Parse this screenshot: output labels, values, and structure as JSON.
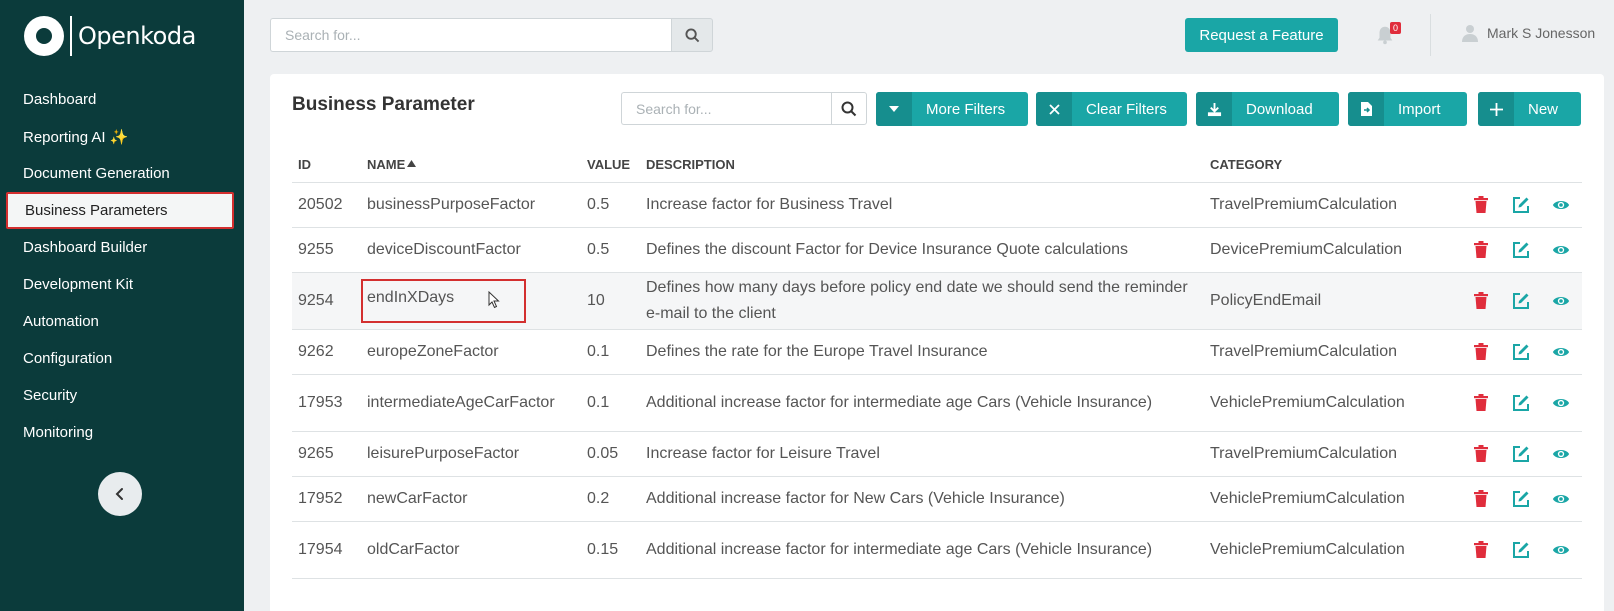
{
  "app": {
    "logo_text": "Openkoda"
  },
  "sidebar": {
    "items": [
      {
        "label": "Dashboard",
        "active": false
      },
      {
        "label": "Reporting AI ✨",
        "active": false
      },
      {
        "label": "Document Generation",
        "active": false
      },
      {
        "label": "Business Parameters",
        "active": true
      },
      {
        "label": "Dashboard Builder",
        "active": false
      },
      {
        "label": "Development Kit",
        "active": false
      },
      {
        "label": "Automation",
        "active": false
      },
      {
        "label": "Configuration",
        "active": false
      },
      {
        "label": "Security",
        "active": false
      },
      {
        "label": "Monitoring",
        "active": false
      }
    ],
    "collapse_icon": "chevron-left-icon"
  },
  "header": {
    "search_placeholder": "Search for...",
    "request_feature_label": "Request a Feature",
    "notification_count": "0",
    "user_name": "Mark S Jonesson"
  },
  "page": {
    "title": "Business Parameter",
    "search_placeholder": "Search for...",
    "buttons": {
      "more_filters": "More Filters",
      "clear_filters": "Clear Filters",
      "download": "Download",
      "import": "Import",
      "new": "New"
    }
  },
  "table": {
    "headers": {
      "id": "ID",
      "name": "NAME",
      "value": "VALUE",
      "description": "DESCRIPTION",
      "category": "CATEGORY"
    },
    "sort": {
      "column": "NAME",
      "direction": "ascending"
    },
    "rows": [
      {
        "id": "20502",
        "name": "businessPurposeFactor",
        "value": "0.5",
        "description": "Increase factor for Business Travel",
        "category": "TravelPremiumCalculation"
      },
      {
        "id": "9255",
        "name": "deviceDiscountFactor",
        "value": "0.5",
        "description": "Defines the discount Factor for Device Insurance Quote calculations",
        "category": "DevicePremiumCalculation"
      },
      {
        "id": "9254",
        "name": "endInXDays",
        "value": "10",
        "description": "Defines how many days before policy end date we should send the reminder e-mail to the client",
        "category": "PolicyEndEmail"
      },
      {
        "id": "9262",
        "name": "europeZoneFactor",
        "value": "0.1",
        "description": "Defines the rate for the Europe Travel Insurance",
        "category": "TravelPremiumCalculation"
      },
      {
        "id": "17953",
        "name": "intermediateAgeCarFactor",
        "value": "0.1",
        "description": "Additional increase factor for intermediate age Cars (Vehicle Insurance)",
        "category": "VehiclePremiumCalculation"
      },
      {
        "id": "9265",
        "name": "leisurePurposeFactor",
        "value": "0.05",
        "description": "Increase factor for Leisure Travel",
        "category": "TravelPremiumCalculation"
      },
      {
        "id": "17952",
        "name": "newCarFactor",
        "value": "0.2",
        "description": "Additional increase factor for New Cars (Vehicle Insurance)",
        "category": "VehiclePremiumCalculation"
      },
      {
        "id": "17954",
        "name": "oldCarFactor",
        "value": "0.15",
        "description": "Additional increase factor for intermediate age Cars (Vehicle Insurance)",
        "category": "VehiclePremiumCalculation"
      }
    ]
  },
  "colors": {
    "sidebar_bg": "#0b3b3b",
    "accent": "#1aa6a6",
    "delete": "#e02d3c",
    "highlight_border": "#d32f2f"
  }
}
